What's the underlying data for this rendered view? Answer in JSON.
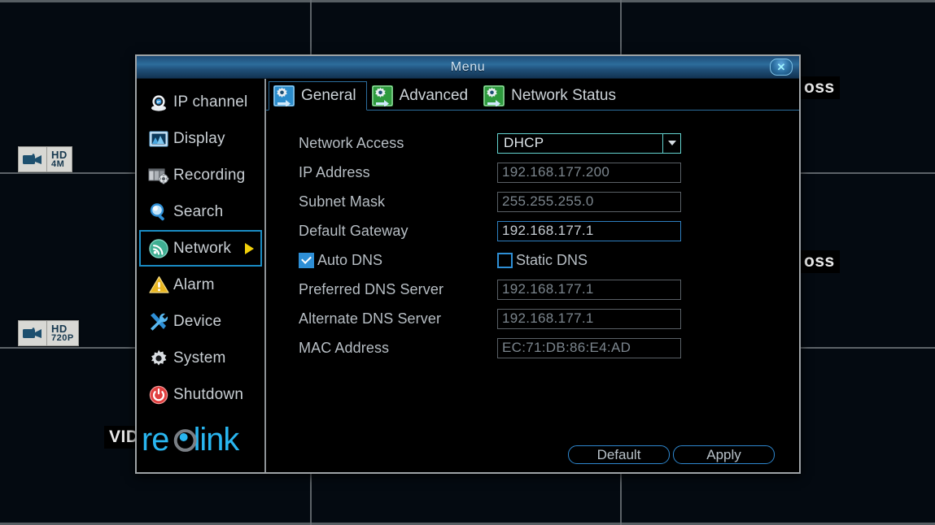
{
  "window": {
    "title": "Menu",
    "close_label": "✕"
  },
  "sidebar": {
    "items": [
      {
        "label": "IP channel",
        "icon": "ip-camera-icon",
        "active": false,
        "arrow": false
      },
      {
        "label": "Display",
        "icon": "display-icon",
        "active": false,
        "arrow": false
      },
      {
        "label": "Recording",
        "icon": "recording-icon",
        "active": false,
        "arrow": false
      },
      {
        "label": "Search",
        "icon": "magnifier-icon",
        "active": false,
        "arrow": false
      },
      {
        "label": "Network",
        "icon": "wifi-signal-icon",
        "active": true,
        "arrow": true
      },
      {
        "label": "Alarm",
        "icon": "warning-icon",
        "active": false,
        "arrow": false
      },
      {
        "label": "Device",
        "icon": "tools-icon",
        "active": false,
        "arrow": false
      },
      {
        "label": "System",
        "icon": "gear-icon",
        "active": false,
        "arrow": false
      },
      {
        "label": "Shutdown",
        "icon": "power-icon",
        "active": false,
        "arrow": false
      }
    ],
    "brand": "reolink"
  },
  "tabs": [
    {
      "label": "General",
      "icon": "gear-arrow-blue-icon",
      "active": true
    },
    {
      "label": "Advanced",
      "icon": "gear-arrow-green-icon",
      "active": false
    },
    {
      "label": "Network Status",
      "icon": "gear-arrow-green-icon",
      "active": false
    }
  ],
  "form": {
    "network_access": {
      "label": "Network Access",
      "value": "DHCP",
      "type": "combo"
    },
    "ip_address": {
      "label": "IP Address",
      "value": "192.168.177.200",
      "type": "readonly"
    },
    "subnet_mask": {
      "label": "Subnet Mask",
      "value": "255.255.255.0",
      "type": "readonly"
    },
    "default_gateway": {
      "label": "Default Gateway",
      "value": "192.168.177.1",
      "type": "editable"
    },
    "auto_dns": {
      "label": "Auto DNS",
      "checked": true
    },
    "static_dns": {
      "label": "Static DNS",
      "checked": false
    },
    "preferred_dns": {
      "label": "Preferred DNS Server",
      "value": "192.168.177.1",
      "type": "readonly"
    },
    "alternate_dns": {
      "label": "Alternate DNS Server",
      "value": "192.168.177.1",
      "type": "readonly"
    },
    "mac_address": {
      "label": "MAC Address",
      "value": "EC:71:DB:86:E4:AD",
      "type": "readonly"
    }
  },
  "buttons": {
    "default": "Default",
    "apply": "Apply"
  },
  "video_wall": {
    "badges": [
      {
        "hd": "HD",
        "res": "4M"
      },
      {
        "hd": "HD",
        "res": "720P"
      }
    ],
    "overlays": [
      {
        "text": "oss"
      },
      {
        "text": "oss"
      },
      {
        "text": "VID"
      }
    ]
  },
  "colors": {
    "accent_blue": "#2e87cf",
    "titlebar_blue": "#2d6d9c",
    "combo_cyan": "#63d3cf",
    "arrow_yellow": "#f2d10a",
    "brand_cyan": "#29b6f0"
  }
}
